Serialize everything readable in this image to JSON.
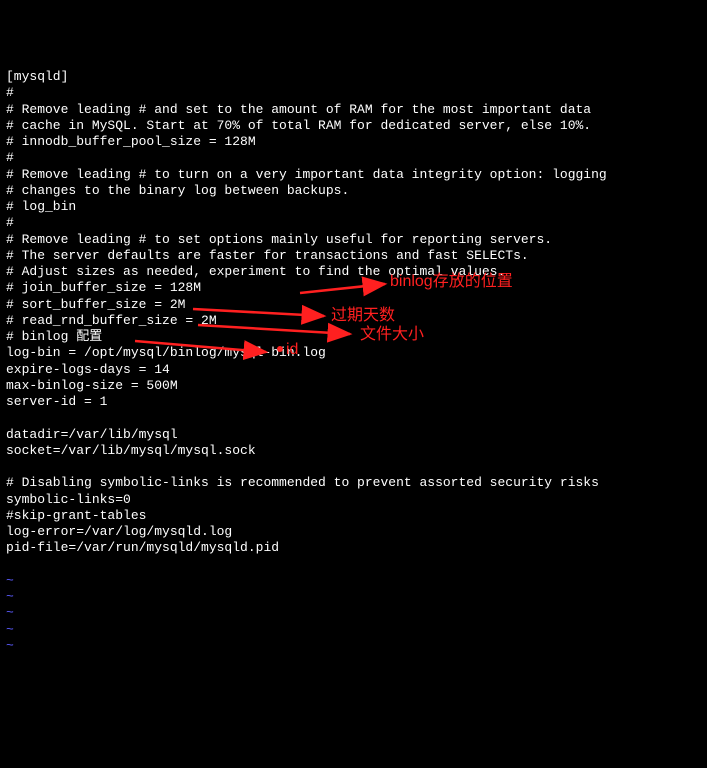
{
  "lines": [
    "[mysqld]",
    "#",
    "# Remove leading # and set to the amount of RAM for the most important data",
    "# cache in MySQL. Start at 70% of total RAM for dedicated server, else 10%.",
    "# innodb_buffer_pool_size = 128M",
    "#",
    "# Remove leading # to turn on a very important data integrity option: logging",
    "# changes to the binary log between backups.",
    "# log_bin",
    "#",
    "# Remove leading # to set options mainly useful for reporting servers.",
    "# The server defaults are faster for transactions and fast SELECTs.",
    "# Adjust sizes as needed, experiment to find the optimal values.",
    "# join_buffer_size = 128M",
    "# sort_buffer_size = 2M",
    "# read_rnd_buffer_size = 2M",
    "# binlog 配置",
    "log-bin = /opt/mysql/binlog/mysql-bin.log",
    "expire-logs-days = 14",
    "max-binlog-size = 500M",
    "server-id = 1",
    "",
    "datadir=/var/lib/mysql",
    "socket=/var/lib/mysql/mysql.sock",
    "",
    "# Disabling symbolic-links is recommended to prevent assorted security risks",
    "symbolic-links=0",
    "#skip-grant-tables",
    "log-error=/var/log/mysqld.log",
    "pid-file=/var/run/mysqld/mysqld.pid"
  ],
  "tildes": [
    "~",
    "~",
    "~",
    "~",
    "~"
  ],
  "annotations": {
    "binlog_location": "binlog存放的位置",
    "expire_days": "过期天数",
    "file_size": "文件大小",
    "id": "id"
  }
}
